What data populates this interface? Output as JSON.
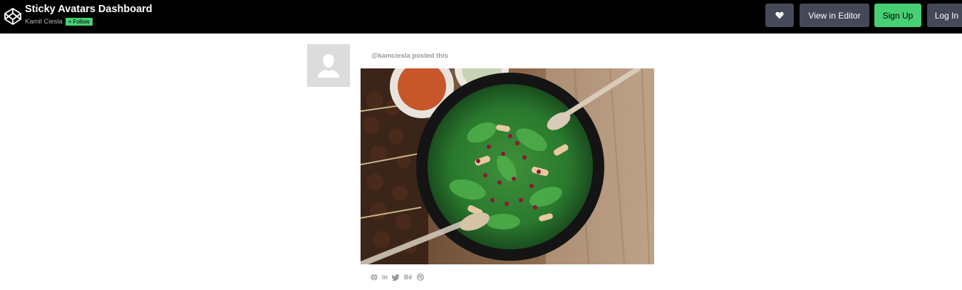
{
  "header": {
    "title": "Sticky Avatars Dashboard",
    "author": "Kamil Ciesla",
    "follow_label": "Follow",
    "buttons": {
      "heart_icon": "heart-icon",
      "view_in_editor": "View in Editor",
      "sign_up": "Sign Up",
      "log_in": "Log In"
    }
  },
  "post": {
    "posted_text": "@kamciesla posted this",
    "image_alt": "salad bowl photo",
    "socials": [
      "globe-icon",
      "linkedin-icon",
      "twitter-icon",
      "behance-icon",
      "dribbble-icon"
    ],
    "behance_label": "Bē",
    "linkedin_label": "in"
  },
  "colors": {
    "topbar": "#000000",
    "button_dark": "#444857",
    "button_green": "#47cf73"
  }
}
